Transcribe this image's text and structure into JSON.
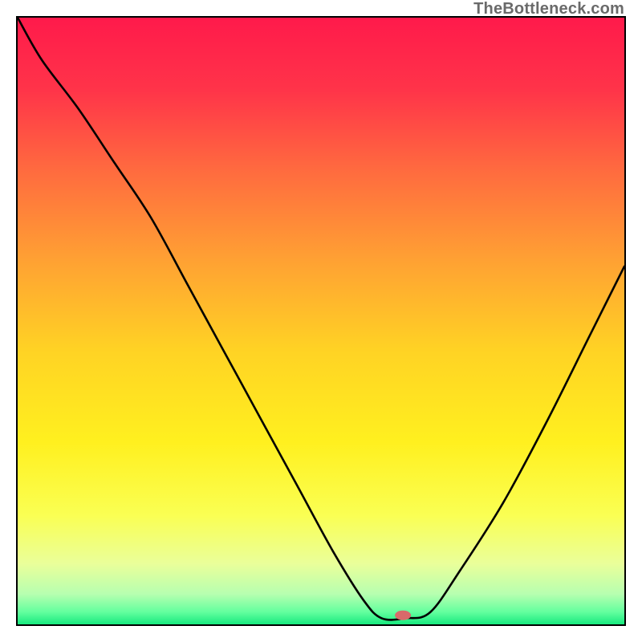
{
  "watermark": "TheBottleneck.com",
  "gradient_stops": [
    {
      "offset": 0,
      "color": "#ff1a4b"
    },
    {
      "offset": 12,
      "color": "#ff3449"
    },
    {
      "offset": 25,
      "color": "#ff6a3f"
    },
    {
      "offset": 40,
      "color": "#ffa133"
    },
    {
      "offset": 55,
      "color": "#ffd324"
    },
    {
      "offset": 70,
      "color": "#fff01f"
    },
    {
      "offset": 82,
      "color": "#faff53"
    },
    {
      "offset": 90,
      "color": "#eaff9a"
    },
    {
      "offset": 95,
      "color": "#b7ffb0"
    },
    {
      "offset": 98,
      "color": "#62ff9e"
    },
    {
      "offset": 100,
      "color": "#18e97e"
    }
  ],
  "marker": {
    "color": "#d86a6a",
    "rx": 10,
    "ry": 6,
    "cx": 0.635,
    "cy": 0.985
  },
  "chart_data": {
    "type": "line",
    "title": "",
    "xlabel": "",
    "ylabel": "",
    "xlim": [
      0,
      1
    ],
    "ylim": [
      0,
      1
    ],
    "legend": false,
    "grid": false,
    "series": [
      {
        "name": "bottleneck-curve",
        "note": "y is fraction from top (0=top,1=bottom); minimum (best) near x≈0.62",
        "x": [
          0.0,
          0.04,
          0.1,
          0.16,
          0.22,
          0.28,
          0.34,
          0.4,
          0.46,
          0.52,
          0.57,
          0.6,
          0.64,
          0.68,
          0.73,
          0.8,
          0.87,
          0.94,
          1.0
        ],
        "y": [
          0.0,
          0.07,
          0.15,
          0.24,
          0.33,
          0.44,
          0.55,
          0.66,
          0.77,
          0.88,
          0.96,
          0.99,
          0.99,
          0.98,
          0.91,
          0.8,
          0.67,
          0.53,
          0.41
        ]
      }
    ],
    "background_gradient": "vertical red→orange→yellow→green",
    "optimal_marker_x": 0.635
  }
}
